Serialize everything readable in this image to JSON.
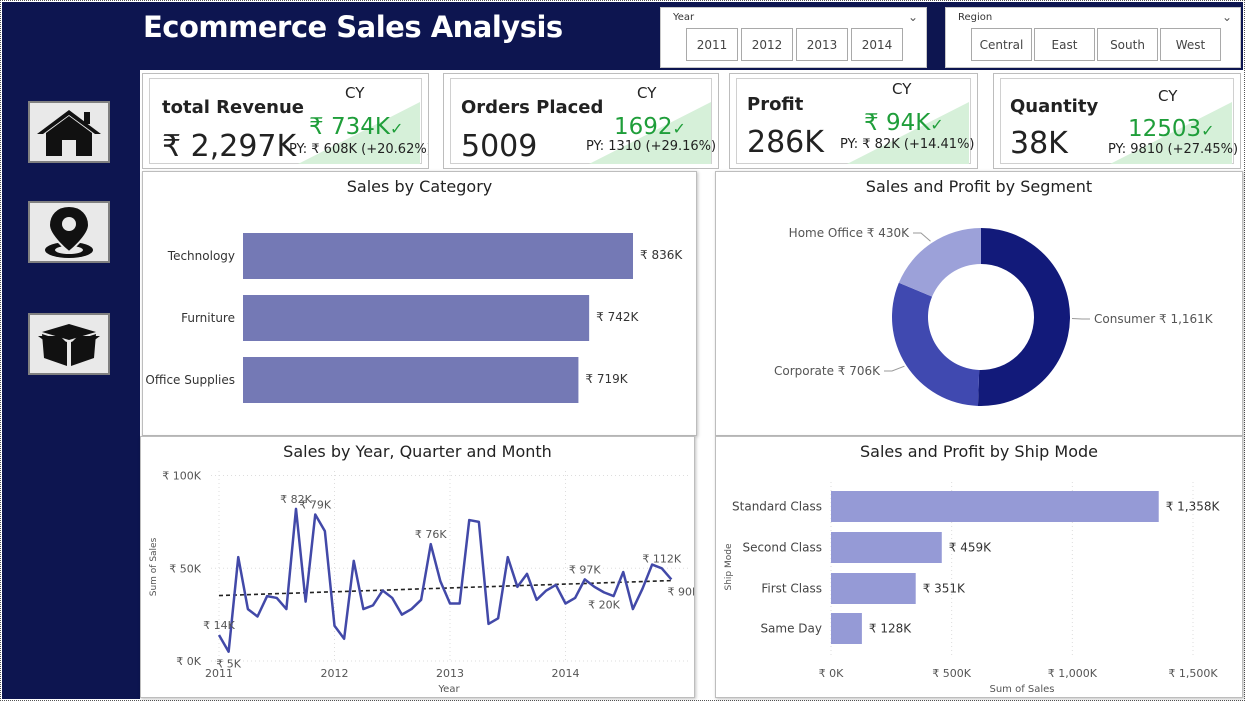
{
  "header": {
    "title": "Ecommerce Sales Analysis"
  },
  "nav": [
    {
      "icon": "home-icon"
    },
    {
      "icon": "map-pin-icon"
    },
    {
      "icon": "product-box-icon"
    }
  ],
  "slicers": {
    "year": {
      "label": "Year",
      "options": [
        "2011",
        "2012",
        "2013",
        "2014"
      ]
    },
    "region": {
      "label": "Region",
      "options": [
        "Central",
        "East",
        "South",
        "West"
      ]
    }
  },
  "kpis": [
    {
      "name": "total Revenue",
      "value": "₹ 2,297K",
      "cy_label": "CY",
      "current": "₹ 734K",
      "py": "PY: ₹ 608K (+20.62%)"
    },
    {
      "name": "Orders Placed",
      "value": "5009",
      "cy_label": "CY",
      "current": "1692",
      "py": "PY: 1310 (+29.16%)"
    },
    {
      "name": "Profit",
      "value": "286K",
      "cy_label": "CY",
      "current": "₹ 94K",
      "py": "PY: ₹ 82K (+14.41%)"
    },
    {
      "name": "Quantity",
      "value": "38K",
      "cy_label": "CY",
      "current": "12503",
      "py": "PY: 9810 (+27.45%)"
    }
  ],
  "colors": {
    "navy": "#0d1550",
    "bar": "#7479b5",
    "line": "#4249a8",
    "ship_bar": "#959ad6",
    "green": "#1f9e3a",
    "donut": [
      "#121a7a",
      "#4049b0",
      "#9ca1d9"
    ]
  },
  "chart_data": [
    {
      "id": "category",
      "type": "bar",
      "title": "Sales by Category",
      "orientation": "horizontal",
      "categories": [
        "Technology",
        "Furniture",
        "Office Supplies"
      ],
      "values": [
        836,
        742,
        719
      ],
      "labels": [
        "₹ 836K",
        "₹ 742K",
        "₹ 719K"
      ],
      "unit": "₹K"
    },
    {
      "id": "segment",
      "type": "pie",
      "title": "Sales and Profit by Segment",
      "donut": true,
      "categories": [
        "Consumer",
        "Corporate",
        "Home Office"
      ],
      "values": [
        1161,
        706,
        430
      ],
      "labels": [
        "Consumer ₹ 1,161K",
        "Corporate ₹ 706K",
        "Home Office ₹ 430K"
      ]
    },
    {
      "id": "trend",
      "type": "line",
      "title": "Sales by Year, Quarter and Month",
      "xlabel": "Year",
      "ylabel": "Sum of Sales",
      "x_ticks": [
        "2011",
        "2012",
        "2013",
        "2014"
      ],
      "y_ticks": [
        "₹ 0K",
        "₹ 50K",
        "₹ 100K"
      ],
      "ylim": [
        0,
        110
      ],
      "months": [
        "2011-01",
        "2011-02",
        "2011-03",
        "2011-04",
        "2011-05",
        "2011-06",
        "2011-07",
        "2011-08",
        "2011-09",
        "2011-10",
        "2011-11",
        "2011-12",
        "2012-01",
        "2012-02",
        "2012-03",
        "2012-04",
        "2012-05",
        "2012-06",
        "2012-07",
        "2012-08",
        "2012-09",
        "2012-10",
        "2012-11",
        "2012-12",
        "2013-01",
        "2013-02",
        "2013-03",
        "2013-04",
        "2013-05",
        "2013-06",
        "2013-07",
        "2013-08",
        "2013-09",
        "2013-10",
        "2013-11",
        "2013-12",
        "2014-01",
        "2014-02",
        "2014-03",
        "2014-04",
        "2014-05",
        "2014-06",
        "2014-07",
        "2014-08",
        "2014-09",
        "2014-10",
        "2014-11",
        "2014-12"
      ],
      "values": [
        14,
        5,
        56,
        28,
        24,
        35,
        34,
        28,
        82,
        32,
        79,
        70,
        19,
        12,
        54,
        28,
        30,
        38,
        34,
        25,
        28,
        33,
        63,
        43,
        31,
        31,
        76,
        75,
        20,
        23,
        56,
        40,
        47,
        33,
        38,
        41,
        31,
        34,
        44,
        40,
        37,
        35,
        48,
        28,
        39,
        52,
        50,
        44
      ],
      "trend": true,
      "annotations": [
        {
          "month": "2011-01",
          "text": "₹ 14K"
        },
        {
          "month": "2011-02",
          "text": "₹ 5K"
        },
        {
          "month": "2011-09",
          "text": "₹ 82K"
        },
        {
          "month": "2011-11",
          "text": "₹ 79K"
        },
        {
          "month": "2012-11",
          "text": "₹ 76K"
        },
        {
          "month": "2014-03",
          "text": "₹ 97K"
        },
        {
          "month": "2014-05",
          "text": "₹ 20K"
        },
        {
          "month": "2014-11",
          "text": "₹ 112K"
        },
        {
          "month": "2014-12",
          "text": "₹ 90K"
        }
      ]
    },
    {
      "id": "shipmode",
      "type": "bar",
      "title": "Sales and Profit by Ship Mode",
      "orientation": "horizontal",
      "xlabel": "Sum of Sales",
      "ylabel": "Ship Mode",
      "categories": [
        "Standard Class",
        "Second Class",
        "First Class",
        "Same Day"
      ],
      "values": [
        1358,
        459,
        351,
        128
      ],
      "labels": [
        "₹ 1,358K",
        "₹ 459K",
        "₹ 351K",
        "₹ 128K"
      ],
      "x_ticks": [
        "₹ 0K",
        "₹ 500K",
        "₹ 1,000K",
        "₹ 1,500K"
      ],
      "xlim": [
        0,
        1500
      ]
    }
  ]
}
